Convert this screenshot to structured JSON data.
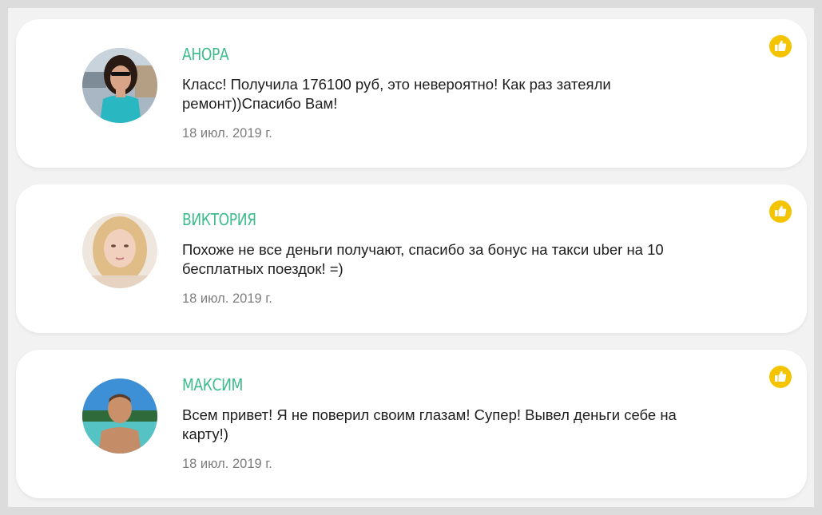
{
  "reviews": [
    {
      "name": "АНОРА",
      "text": "Класс! Получила 176100 руб, это невероятно! Как раз затеяли ремонт))Спасибо Вам!",
      "date": "18 июл. 2019 г.",
      "avatar_icon": "user-photo-woman-dark-hair",
      "like_icon": "thumbs-up-icon"
    },
    {
      "name": "ВИКТОРИЯ",
      "text": "Похоже не все деньги получают, спасибо за бонус на такси uber на 10 бесплатных поездок! =)",
      "date": "18 июл. 2019 г.",
      "avatar_icon": "user-photo-woman-blonde",
      "like_icon": "thumbs-up-icon"
    },
    {
      "name": "МАКСИМ",
      "text": "Всем привет! Я не поверил своим глазам! Супер! Вывел деньги себе на карту!)",
      "date": "18 июл. 2019 г.",
      "avatar_icon": "user-photo-man-beach",
      "like_icon": "thumbs-up-icon"
    }
  ],
  "colors": {
    "name": "#3ebc8c",
    "like_badge": "#f5c400",
    "card_bg": "#ffffff",
    "page_bg": "#f2f2f2"
  }
}
